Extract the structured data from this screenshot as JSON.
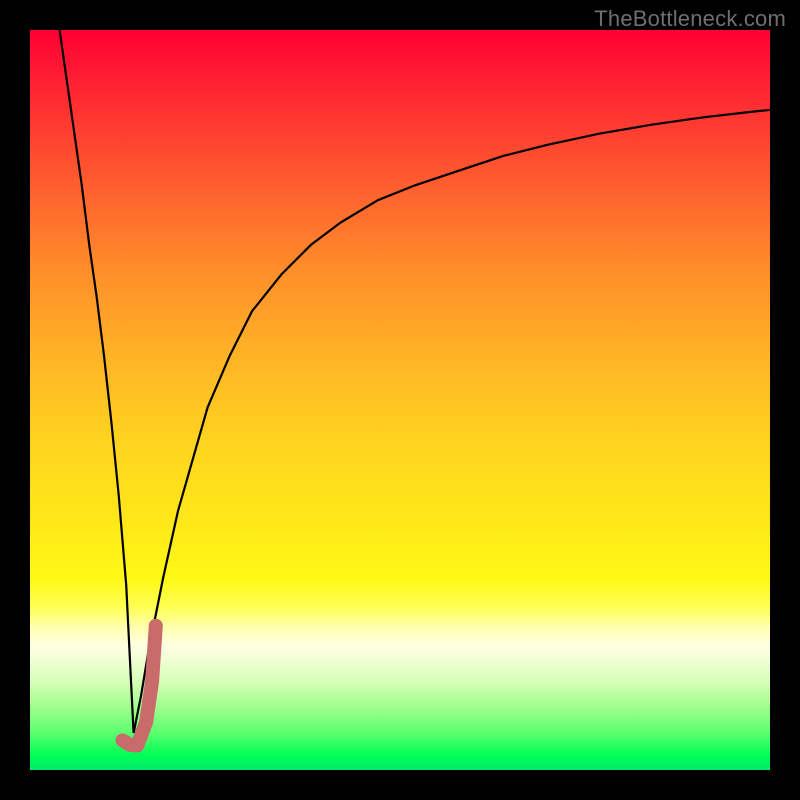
{
  "watermark": "TheBottleneck.com",
  "chart_data": {
    "type": "line",
    "title": "",
    "xlabel": "",
    "ylabel": "",
    "xlim": [
      0,
      100
    ],
    "ylim": [
      0,
      100
    ],
    "grid": false,
    "legend": false,
    "series": [
      {
        "name": "left-branch",
        "stroke": "#000000",
        "stroke_width": 2.2,
        "x": [
          4,
          5,
          6,
          7,
          8,
          9,
          10,
          11,
          12,
          13,
          14
        ],
        "y": [
          100,
          93,
          86,
          79,
          71,
          64,
          56,
          47,
          37,
          25,
          5
        ]
      },
      {
        "name": "right-branch",
        "stroke": "#000000",
        "stroke_width": 2.2,
        "x": [
          14,
          15,
          16,
          18,
          20,
          22,
          24,
          27,
          30,
          34,
          38,
          42,
          47,
          52,
          58,
          64,
          70,
          77,
          84,
          91,
          98,
          100
        ],
        "y": [
          5,
          10,
          16,
          26,
          35,
          42,
          49,
          56,
          62,
          67,
          71,
          74,
          77,
          79,
          81,
          83,
          84.5,
          86,
          87.2,
          88.2,
          89,
          89.2
        ]
      },
      {
        "name": "highlight-stub",
        "stroke": "#c96b6b",
        "stroke_width": 14,
        "linecap": "round",
        "x": [
          12.5,
          13.5,
          14.5,
          15.7,
          16.5,
          17.0
        ],
        "y": [
          4.0,
          3.4,
          3.3,
          6.5,
          12.0,
          19.5
        ]
      }
    ],
    "background": {
      "type": "vertical-gradient",
      "stops": [
        {
          "pos": 0,
          "color": "#ff0033"
        },
        {
          "pos": 20,
          "color": "#ff5a2f"
        },
        {
          "pos": 44,
          "color": "#ffb326"
        },
        {
          "pos": 67,
          "color": "#ffe919"
        },
        {
          "pos": 81,
          "color": "#ffffb5"
        },
        {
          "pos": 95,
          "color": "#5bff6e"
        },
        {
          "pos": 100,
          "color": "#00e96a"
        }
      ]
    }
  }
}
